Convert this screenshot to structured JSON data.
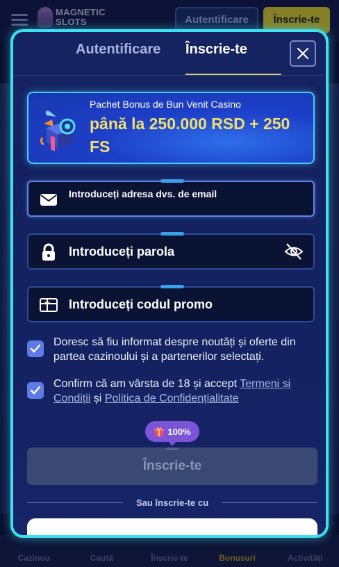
{
  "header": {
    "logo_line1": "MAGNETIC",
    "logo_line2": "SLOTS",
    "login_label": "Autentificare",
    "signup_label": "Înscrie-te"
  },
  "bottom_nav": [
    {
      "label": "Cazinou",
      "icon": "casino-icon"
    },
    {
      "label": "Caută",
      "icon": "search-icon"
    },
    {
      "label": "Înscrie-te",
      "icon": "signup-icon"
    },
    {
      "label": "Bonusuri",
      "icon": "bonus-icon",
      "active": true
    },
    {
      "label": "Activități",
      "icon": "activity-icon"
    }
  ],
  "modal": {
    "tabs": {
      "login": "Autentificare",
      "signup": "Înscrie-te",
      "active": "signup"
    },
    "bonus": {
      "small": "Pachet Bonus de Bun Venit Casino",
      "big": "până la 250.000 RSD + 250 FS"
    },
    "fields": {
      "email_placeholder": "Introduceți adresa dvs. de email",
      "password_placeholder": "Introduceți parola",
      "promo_placeholder": "Introduceți codul promo"
    },
    "checks": {
      "newsletter": "Doresc să fiu informat despre noutăți și oferte din partea cazinoului și a partenerilor selectați.",
      "terms_prefix": "Confirm că am vârsta de 18 și accept ",
      "terms_link": "Termeni și Condiții",
      "terms_and": " și ",
      "privacy_link": "Politica de Confidențialitate"
    },
    "promo_pill": "100%",
    "submit_label": "Înscrie-te",
    "or_label": "Sau înscrie-te cu"
  },
  "colors": {
    "accent_border": "#3de0f0",
    "gold": "#f1de6c",
    "checkbox": "#5d7be6",
    "pill": "#7a55d8"
  }
}
